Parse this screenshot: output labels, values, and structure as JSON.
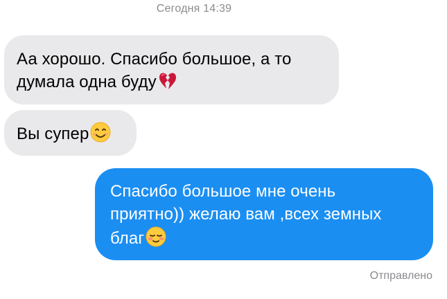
{
  "timestamp": "Сегодня 14:39",
  "messages": [
    {
      "direction": "incoming",
      "lines": [
        "Аа хорошо. Спасибо большое, а то",
        "думала одна буду"
      ],
      "emoji": "broken-heart"
    },
    {
      "direction": "incoming",
      "lines": [
        "Вы супер"
      ],
      "emoji": "smiling-face"
    },
    {
      "direction": "outgoing",
      "lines": [
        "Спасибо большое мне очень",
        "приятно)) желаю вам ,всех земных",
        "благ"
      ],
      "emoji": "blushing-face"
    }
  ],
  "status": "Отправлено",
  "colors": {
    "incoming_bubble": "#e9e9eb",
    "outgoing_bubble": "#1b8ef2",
    "meta_text": "#8a8a8e"
  }
}
